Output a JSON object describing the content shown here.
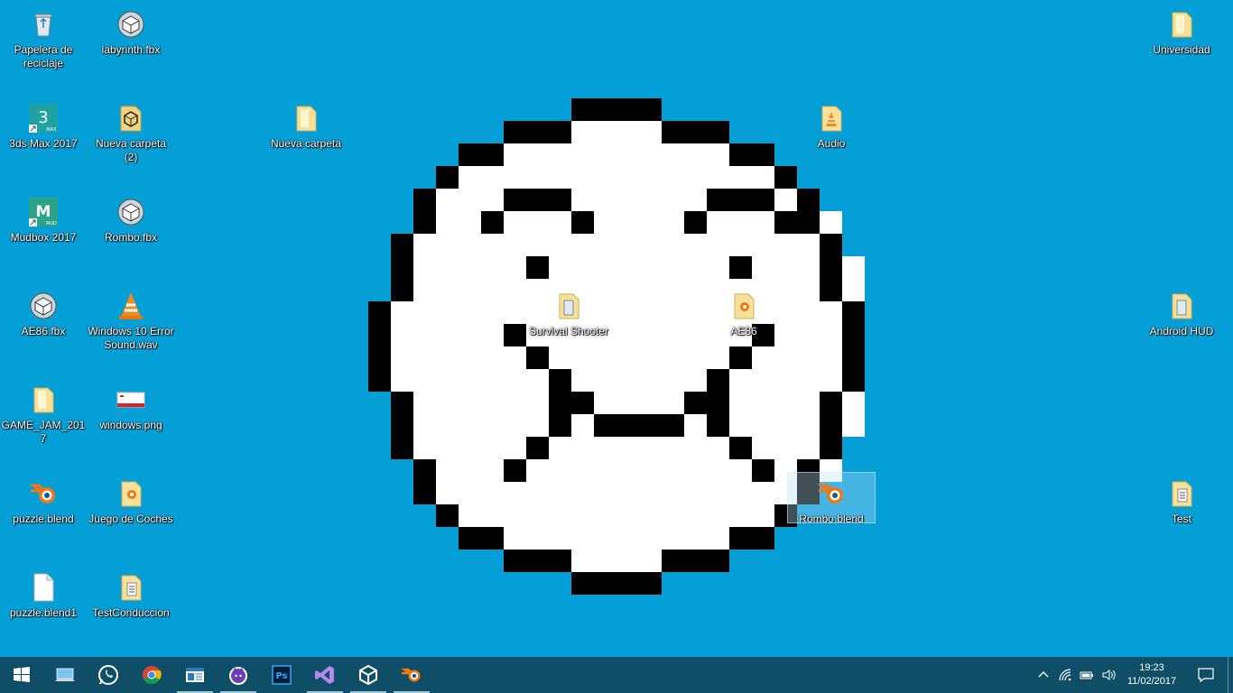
{
  "desktop": {
    "background_color": "#059fd8",
    "wallpaper": "pixel-art-smiling-face",
    "icons": [
      {
        "label": "Papelera de reciclaje",
        "icon": "recycle-bin-icon"
      },
      {
        "label": "labyrinth.fbx",
        "icon": "fbx-model-icon"
      },
      {
        "label": "3ds Max 2017",
        "icon": "3dsmax-icon"
      },
      {
        "label": "Nueva carpeta (2)",
        "icon": "unity-folder-icon"
      },
      {
        "label": "Nueva carpeta",
        "icon": "folder-icon"
      },
      {
        "label": "Mudbox 2017",
        "icon": "mudbox-icon"
      },
      {
        "label": "Rombo.fbx",
        "icon": "fbx-model-icon"
      },
      {
        "label": "AE86.fbx",
        "icon": "fbx-model-icon"
      },
      {
        "label": "Windows 10 Error Sound.wav",
        "icon": "vlc-icon"
      },
      {
        "label": "GAME_JAM_2017",
        "icon": "folder-icon"
      },
      {
        "label": "windows.png",
        "icon": "image-file-icon"
      },
      {
        "label": "puzzle.blend",
        "icon": "blender-icon"
      },
      {
        "label": "Juego de Coches",
        "icon": "folder-icon"
      },
      {
        "label": "puzzle.blend1",
        "icon": "blank-file-icon"
      },
      {
        "label": "TestConduccion",
        "icon": "folder-icon"
      },
      {
        "label": "Survival Shooter",
        "icon": "folder-icon"
      },
      {
        "label": "AE86",
        "icon": "folder-icon"
      },
      {
        "label": "Audio",
        "icon": "vlc-folder-icon"
      },
      {
        "label": "Rombo.blend",
        "icon": "blender-icon"
      },
      {
        "label": "Universidad",
        "icon": "folder-icon"
      },
      {
        "label": "Android HUD",
        "icon": "folder-icon"
      },
      {
        "label": "Test",
        "icon": "folder-icon"
      }
    ]
  },
  "taskbar": {
    "background_color": "#0e4e67",
    "items": [
      {
        "name": "start",
        "icon": "windows-logo-icon"
      },
      {
        "name": "this-pc",
        "icon": "this-pc-icon"
      },
      {
        "name": "whatsapp",
        "icon": "whatsapp-icon"
      },
      {
        "name": "chrome",
        "icon": "chrome-icon"
      },
      {
        "name": "file-explorer",
        "icon": "file-explorer-icon"
      },
      {
        "name": "cat-app",
        "icon": "cat-icon"
      },
      {
        "name": "photoshop",
        "icon": "photoshop-icon"
      },
      {
        "name": "visual-studio",
        "icon": "visual-studio-icon"
      },
      {
        "name": "unity",
        "icon": "unity-icon"
      },
      {
        "name": "blender",
        "icon": "blender-icon"
      }
    ],
    "tray": {
      "time": "19:23",
      "date": "11/02/2017",
      "icons": [
        "chevron-up-icon",
        "wifi-icon",
        "battery-icon",
        "volume-icon"
      ]
    }
  }
}
